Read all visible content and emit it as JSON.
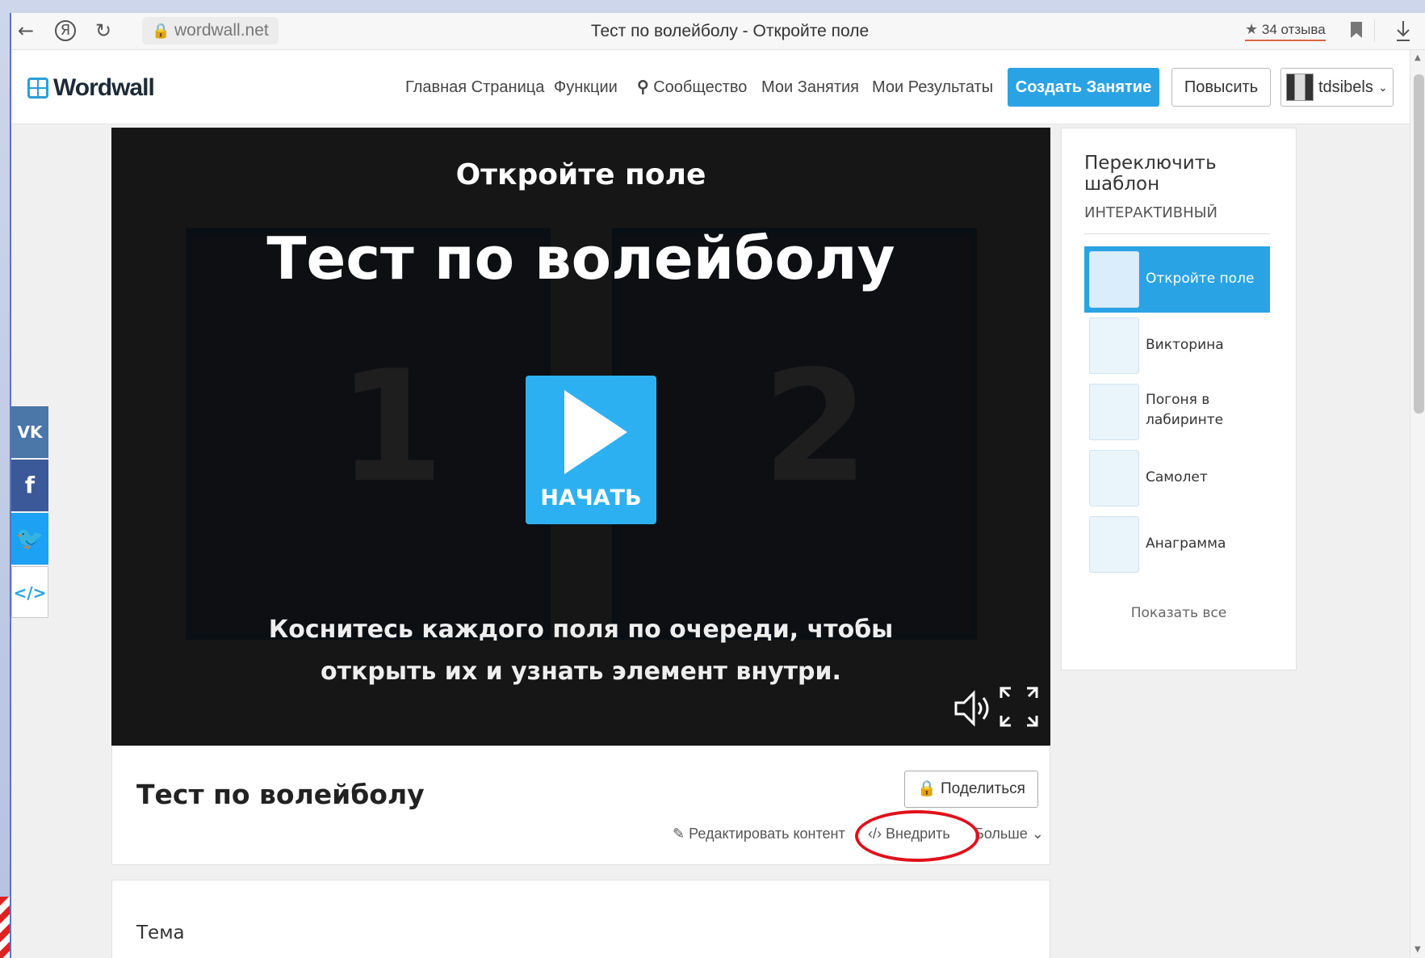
{
  "browser": {
    "back_icon": "←",
    "yandex_icon": "Я",
    "reload_icon": "↻",
    "url": "wordwall.net",
    "tab_title": "Тест по волейболу - Откройте поле",
    "reviews": "34 отзыва",
    "bookmark_icon": "bookmark-icon",
    "download_icon": "download-icon"
  },
  "site_nav": {
    "logo": "Wordwall",
    "links": [
      "Главная Страница",
      "Функции",
      "Сообщество",
      "Мои Занятия",
      "Мои Результаты"
    ],
    "create_button": "Создать Занятие",
    "upgrade_button": "Повысить",
    "username": "tdsibels"
  },
  "game": {
    "template_name": "Откройте поле",
    "title": "Тест по волейболу",
    "num_left": "1",
    "num_right": "2",
    "start_label": "НАЧАТЬ",
    "instruction_line1": "Коснитесь каждого поля по очереди, чтобы",
    "instruction_line2": "открыть их и узнать элемент внутри."
  },
  "info": {
    "activity_title": "Тест по волейболу",
    "share_button": "Поделиться",
    "edit_link": "Редактировать контент",
    "embed_link": "Внедрить",
    "more_link": "Больше",
    "topic_label": "Тема"
  },
  "templates": {
    "heading": "Переключить шаблон",
    "section": "ИНТЕРАКТИВНЫЙ",
    "items": [
      {
        "name": "Откройте поле",
        "active": true
      },
      {
        "name": "Викторина",
        "active": false
      },
      {
        "name": "Погоня в лабиринте",
        "active": false
      },
      {
        "name": "Самолет",
        "active": false
      },
      {
        "name": "Анаграмма",
        "active": false
      }
    ],
    "show_all": "Показать все"
  },
  "colors": {
    "accent": "#2aa3e4",
    "highlight_ellipse": "#e0101a"
  }
}
